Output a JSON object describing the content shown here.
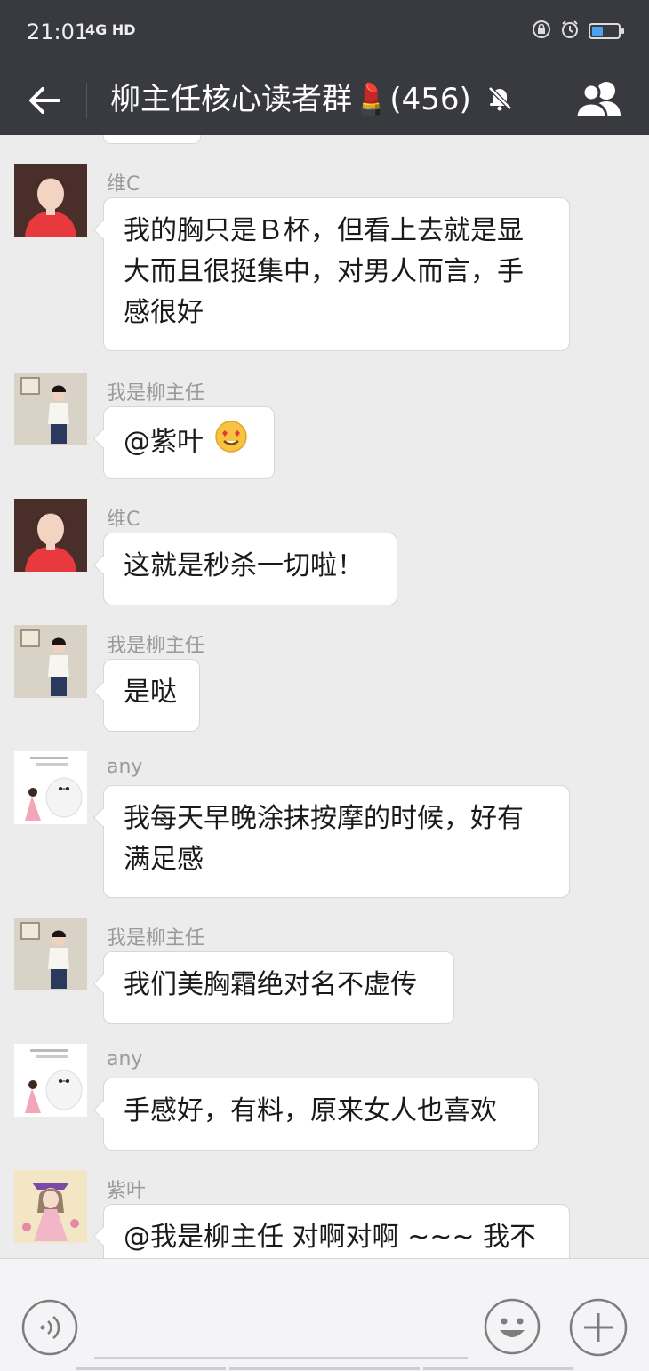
{
  "status_bar": {
    "time": "21:01",
    "network": "4G HD"
  },
  "title_bar": {
    "title": "柳主任核心读者群💄(456)"
  },
  "messages": [
    {
      "sender": "维C",
      "text": "我的胸只是Ｂ杯，但看上去就是显大而且很挺集中，对男人而言，手感很好"
    },
    {
      "sender": "我是柳主任",
      "text": "@紫叶",
      "emoji": "smiling-face-with-heart-eyes"
    },
    {
      "sender": "维C",
      "text": "这就是秒杀一切啦！"
    },
    {
      "sender": "我是柳主任",
      "text": "是哒"
    },
    {
      "sender": "any",
      "text": "我每天早晚涂抹按摩的时候，好有满足感"
    },
    {
      "sender": "我是柳主任",
      "text": "我们美胸霜绝对名不虚传"
    },
    {
      "sender": "any",
      "text": "手感好，有料，原来女人也喜欢"
    },
    {
      "sender": "紫叶",
      "text": "@我是柳主任  对啊对啊 ~~~ 我不想羞大，但是用了自己都感觉手感"
    }
  ],
  "colors": {
    "header_bg": "#393a3f",
    "chat_bg": "#ececec",
    "bubble_bg": "#ffffff",
    "sender_name": "#9a9a9a"
  }
}
